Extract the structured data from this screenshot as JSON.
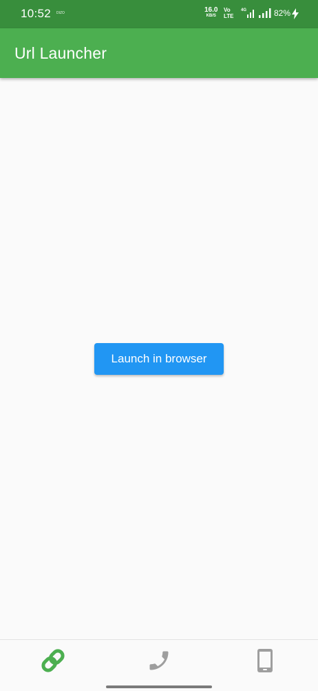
{
  "status_bar": {
    "time": "10:52",
    "carrier_label": "DIZO",
    "net_speed": "16.0",
    "net_speed_unit": "KB/S",
    "volte_top": "Vo",
    "volte_bottom": "LTE",
    "network_type": "4G",
    "battery": "82%"
  },
  "app_bar": {
    "title": "Url Launcher"
  },
  "main": {
    "launch_button_label": "Launch in browser"
  },
  "bottom_nav": {
    "items": [
      {
        "icon": "link-icon",
        "color": "#4caf50",
        "selected": true
      },
      {
        "icon": "phone-icon",
        "color": "#9e9e9e",
        "selected": false
      },
      {
        "icon": "smartphone-icon",
        "color": "#9e9e9e",
        "selected": false
      }
    ]
  },
  "colors": {
    "status_bar": "#388e3c",
    "app_bar": "#4caf50",
    "button": "#2196f3",
    "background": "#fafafa"
  }
}
